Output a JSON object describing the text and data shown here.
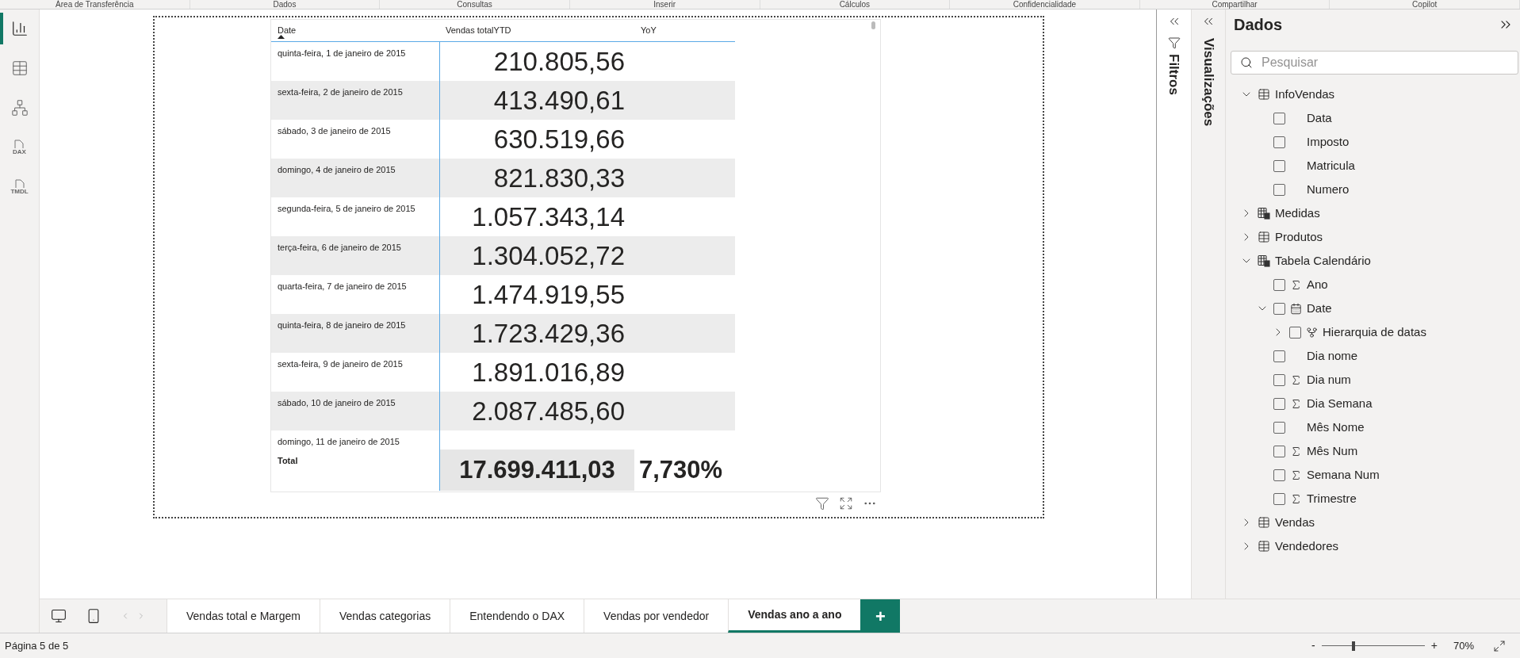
{
  "ribbon_groups": [
    "Área de Transferência",
    "Dados",
    "Consultas",
    "Inserir",
    "Cálculos",
    "Confidencialidade",
    "Compartilhar",
    "Copilot"
  ],
  "nav": [
    {
      "kind": "report",
      "selected": true
    },
    {
      "kind": "table",
      "selected": false
    },
    {
      "kind": "model",
      "selected": false
    },
    {
      "kind": "dax",
      "label": "DAX",
      "selected": false
    },
    {
      "kind": "tmdl",
      "label": "TMDL",
      "selected": false
    }
  ],
  "table": {
    "columns": [
      "Date",
      "Vendas totalYTD",
      "YoY"
    ],
    "rows": [
      {
        "date": "quinta-feira, 1 de janeiro de 2015",
        "value": "210.805,56"
      },
      {
        "date": "sexta-feira, 2 de janeiro de 2015",
        "value": "413.490,61"
      },
      {
        "date": "sábado, 3 de janeiro de 2015",
        "value": "630.519,66"
      },
      {
        "date": "domingo, 4 de janeiro de 2015",
        "value": "821.830,33"
      },
      {
        "date": "segunda-feira, 5 de janeiro de 2015",
        "value": "1.057.343,14"
      },
      {
        "date": "terça-feira, 6 de janeiro de 2015",
        "value": "1.304.052,72"
      },
      {
        "date": "quarta-feira, 7 de janeiro de 2015",
        "value": "1.474.919,55"
      },
      {
        "date": "quinta-feira, 8 de janeiro de 2015",
        "value": "1.723.429,36"
      },
      {
        "date": "sexta-feira, 9 de janeiro de 2015",
        "value": "1.891.016,89"
      },
      {
        "date": "sábado, 10 de janeiro de 2015",
        "value": "2.087.485,60"
      },
      {
        "date": "domingo, 11 de janeiro de 2015"
      }
    ],
    "total": {
      "label": "Total",
      "value": "17.699.411,03",
      "yoy": "7,730%"
    }
  },
  "panes": {
    "filters": "Filtros",
    "visualizations": "Visualizações"
  },
  "data_pane": {
    "title": "Dados",
    "search": {
      "placeholder": "Pesquisar"
    },
    "tree": [
      {
        "label": "InfoVendas",
        "kind": "table",
        "expanded": true,
        "children": [
          {
            "label": "Data",
            "kind": "text",
            "checked": false
          },
          {
            "label": "Imposto",
            "kind": "text",
            "checked": false
          },
          {
            "label": "Matricula",
            "kind": "text",
            "checked": false
          },
          {
            "label": "Numero",
            "kind": "text",
            "checked": false
          }
        ]
      },
      {
        "label": "Medidas",
        "kind": "calc_table",
        "expanded": false
      },
      {
        "label": "Produtos",
        "kind": "table",
        "expanded": false
      },
      {
        "label": "Tabela Calendário",
        "kind": "calc_table",
        "expanded": true,
        "children": [
          {
            "label": "Ano",
            "kind": "number",
            "checked": false
          },
          {
            "label": "Date",
            "kind": "date",
            "checked": false,
            "expanded": true,
            "children": [
              {
                "label": "Hierarquia de datas",
                "kind": "hierarchy",
                "checked": false,
                "expanded": false
              }
            ]
          },
          {
            "label": "Dia nome",
            "kind": "text",
            "checked": false
          },
          {
            "label": "Dia num",
            "kind": "number",
            "checked": false
          },
          {
            "label": "Dia Semana",
            "kind": "number",
            "checked": false
          },
          {
            "label": "Mês Nome",
            "kind": "text",
            "checked": false
          },
          {
            "label": "Mês Num",
            "kind": "number",
            "checked": false
          },
          {
            "label": "Semana Num",
            "kind": "number",
            "checked": false
          },
          {
            "label": "Trimestre",
            "kind": "number",
            "checked": false
          }
        ]
      },
      {
        "label": "Vendas",
        "kind": "table",
        "expanded": false
      },
      {
        "label": "Vendedores",
        "kind": "table",
        "expanded": false
      }
    ]
  },
  "pages": [
    {
      "label": "Vendas total e Margem",
      "selected": false
    },
    {
      "label": "Vendas categorias",
      "selected": false
    },
    {
      "label": "Entendendo o DAX",
      "selected": false
    },
    {
      "label": "Vendas por vendedor",
      "selected": false
    },
    {
      "label": "Vendas ano a ano",
      "selected": true
    }
  ],
  "add_page": "+",
  "status": {
    "page": "Página 5 de 5",
    "zoom_minus": "-",
    "zoom_plus": "+",
    "zoom": {
      "level": 0.3
    },
    "zoom_text": "70%"
  }
}
